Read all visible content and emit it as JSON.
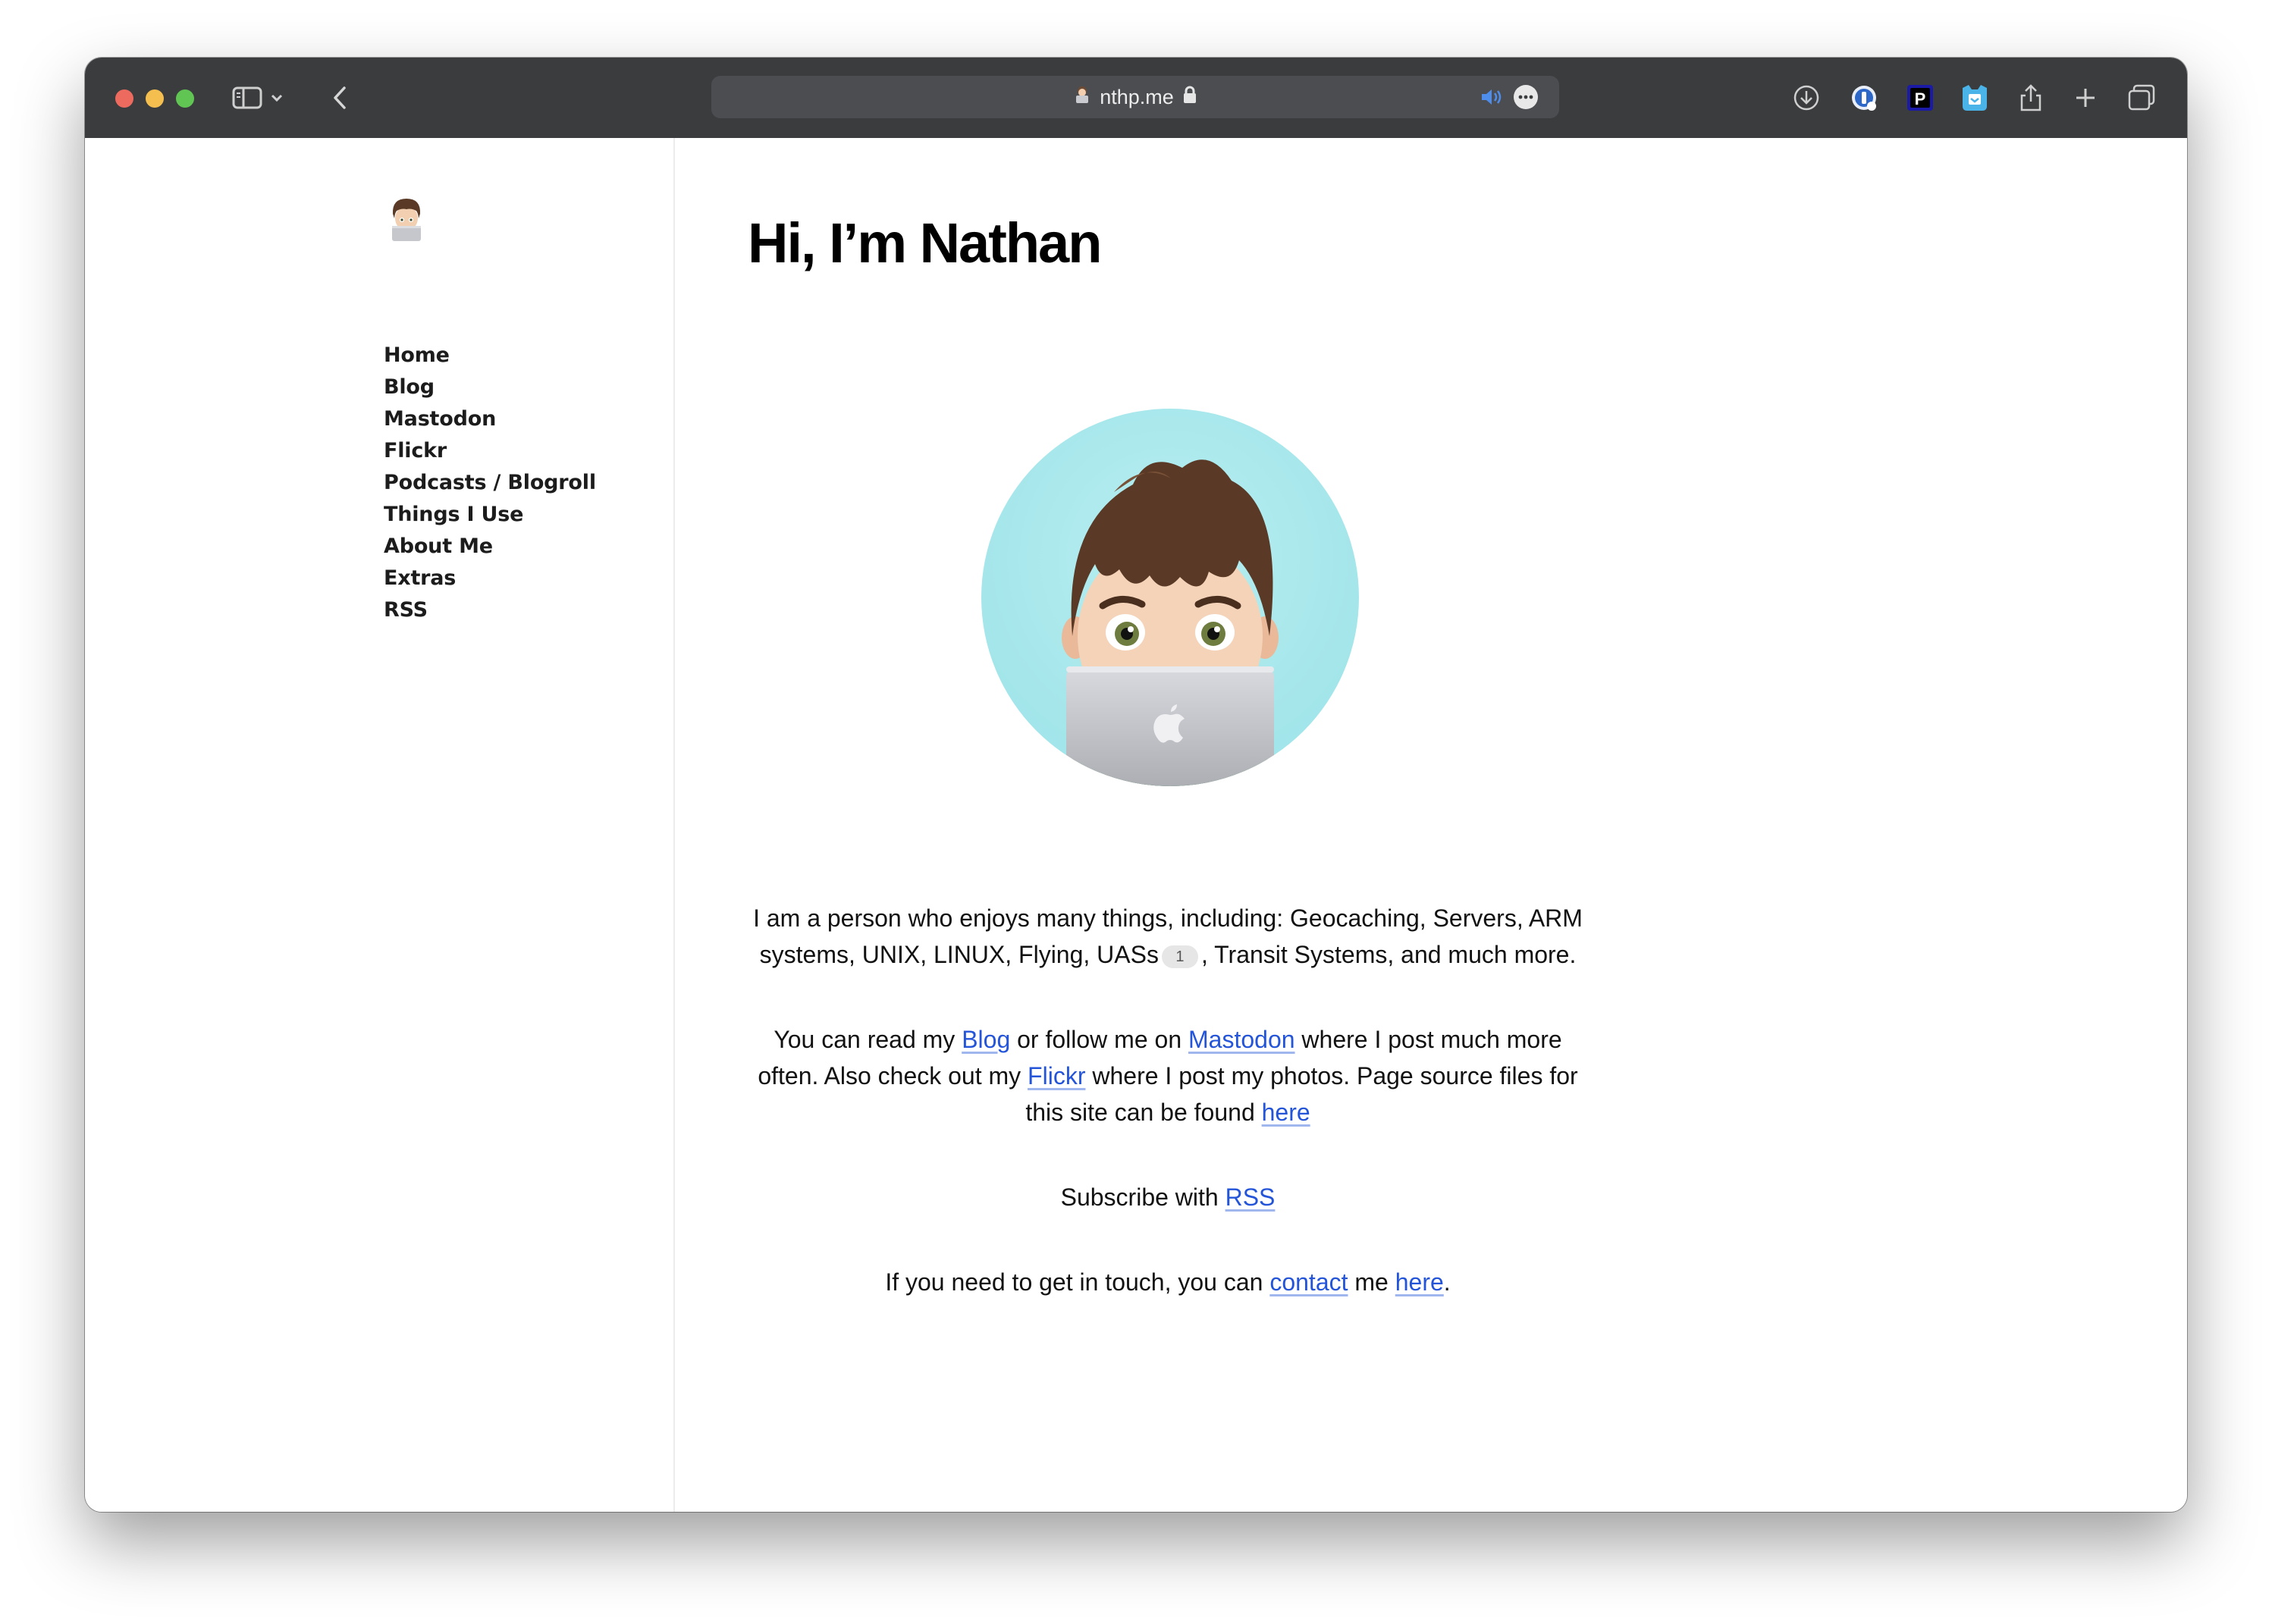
{
  "browser": {
    "url": "nthp.me"
  },
  "sidebar": {
    "nav": [
      {
        "label": "Home"
      },
      {
        "label": "Blog"
      },
      {
        "label": "Mastodon"
      },
      {
        "label": "Flickr"
      },
      {
        "label": "Podcasts / Blogroll"
      },
      {
        "label": "Things I Use"
      },
      {
        "label": "About Me"
      },
      {
        "label": "Extras"
      },
      {
        "label": "RSS"
      }
    ]
  },
  "main": {
    "title": "Hi, I’m Nathan",
    "p1": {
      "text_a": "I am a person who enjoys many things, including: Geocaching, Servers, ARM systems, UNIX, LINUX, Flying, UASs",
      "footnote": "1",
      "text_b": ", Transit Systems, and much more."
    },
    "p2": {
      "t1": "You can read my ",
      "link_blog": "Blog",
      "t2": " or follow me on ",
      "link_mastodon": "Mastodon",
      "t3": " where I post much more often. Also check out my ",
      "link_flickr": "Flickr",
      "t4": " where I post my photos. Page source files for this site can be found ",
      "link_here": "here"
    },
    "p3": {
      "t1": "Subscribe with ",
      "link_rss": "RSS"
    },
    "p4": {
      "t1": "If you need to get in touch, you can ",
      "link_contact": "contact",
      "t2": " me ",
      "link_here": "here",
      "t3": "."
    }
  },
  "colors": {
    "toolbar": "#3a3c3e",
    "link": "#2455d8",
    "avatar_bg": "#a9e8ec"
  }
}
